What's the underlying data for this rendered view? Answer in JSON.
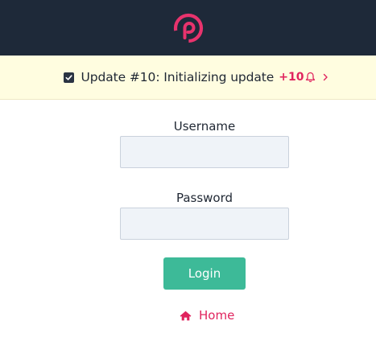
{
  "header": {
    "logo_icon": "brand-p-logo-icon",
    "brand_color": "#e8336d",
    "background": "#1e2939"
  },
  "banner": {
    "checked": true,
    "text": "Update #10: Initializing update",
    "badge": "+10",
    "bell_icon": "bell-icon",
    "chevron_icon": "chevron-right-icon"
  },
  "login_form": {
    "username_label": "Username",
    "username_value": "",
    "password_label": "Password",
    "password_value": "",
    "login_label": "Login"
  },
  "home_link": {
    "label": "Home",
    "icon": "home-icon"
  },
  "colors": {
    "accent": "#e0245e",
    "button": "#3dba98",
    "banner_bg": "#fffde0",
    "input_bg": "#eff3f8"
  }
}
